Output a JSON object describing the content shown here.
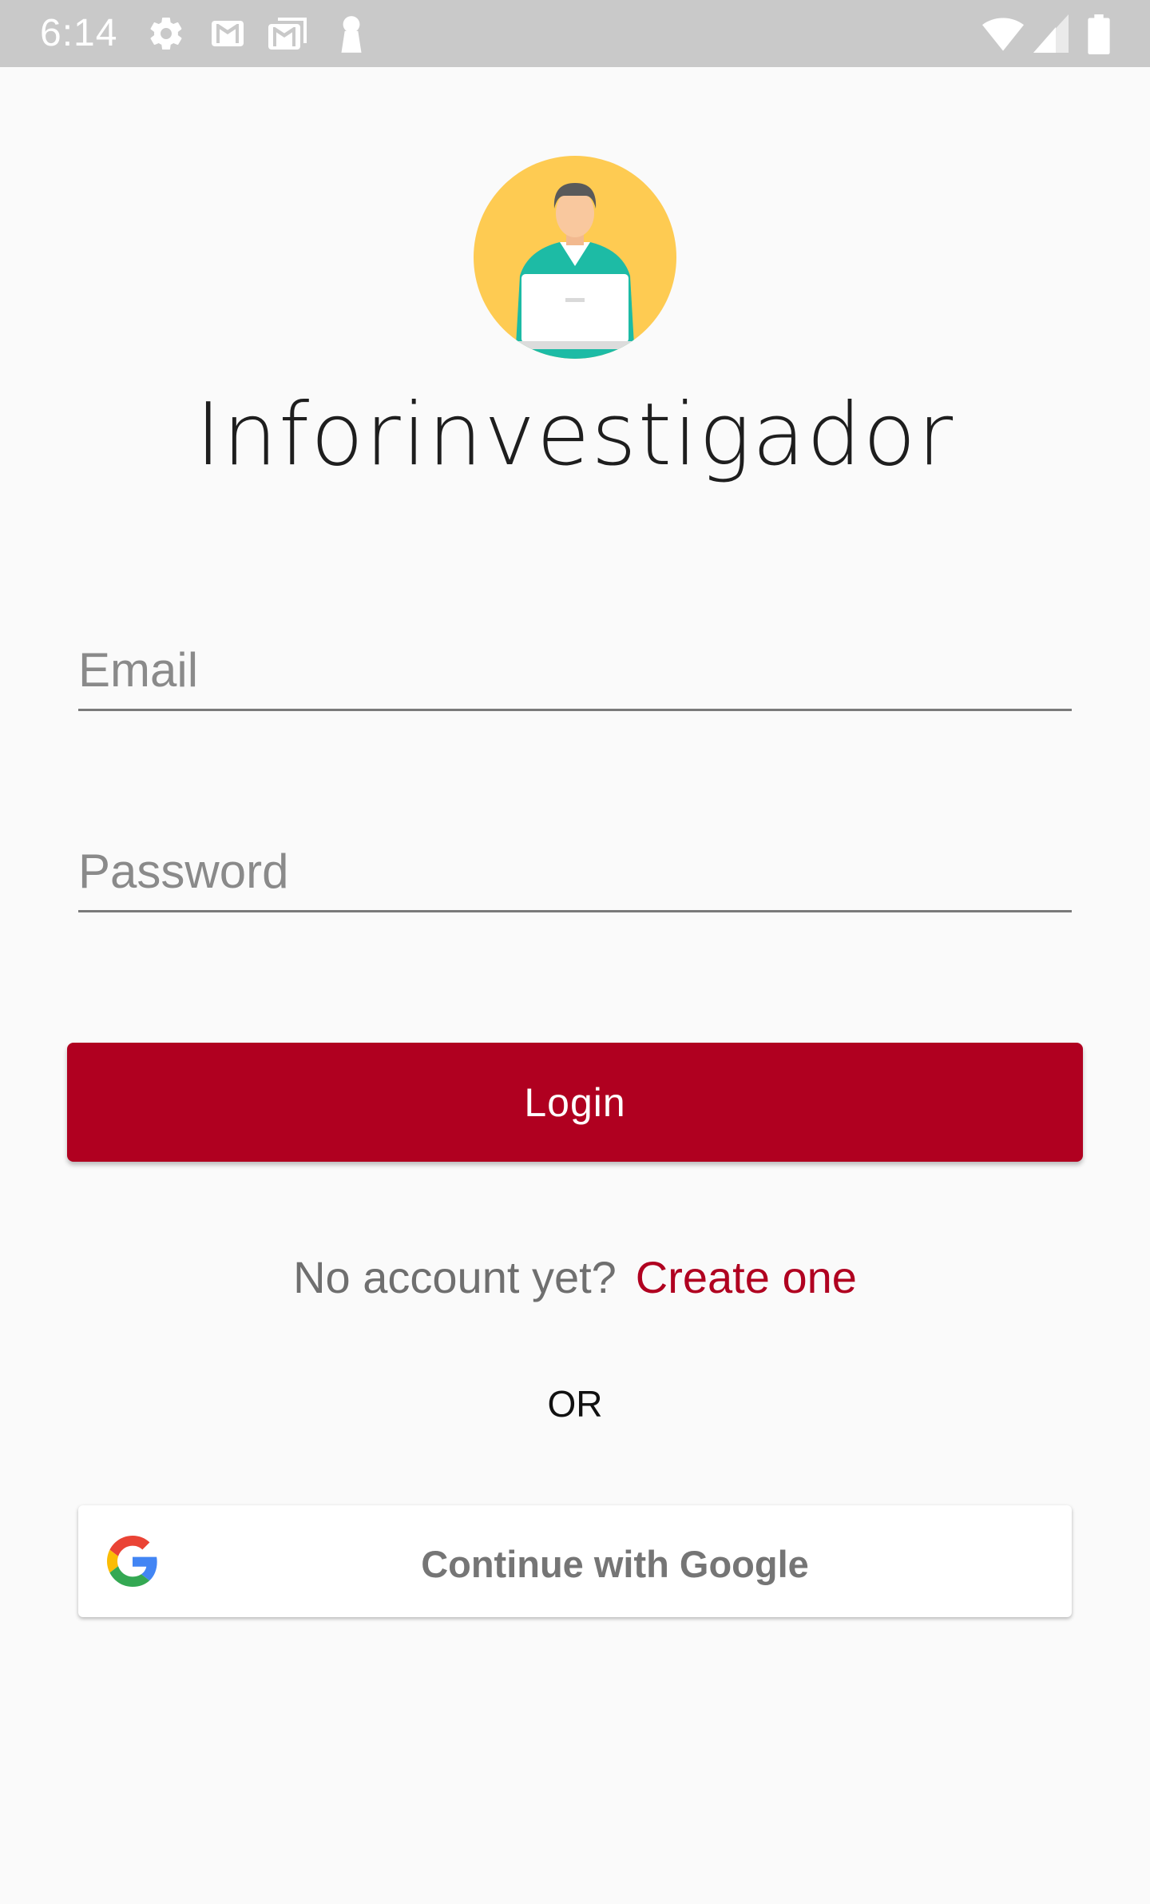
{
  "status_bar": {
    "time": "6:14",
    "icons": [
      "gear-icon",
      "gmail-icon",
      "gmail-stack-icon",
      "keyhole-icon",
      "wifi-icon",
      "signal-icon",
      "battery-icon"
    ]
  },
  "app": {
    "title": "Inforinvestigador",
    "accent_color": "#b00020"
  },
  "form": {
    "email_placeholder": "Email",
    "password_placeholder": "Password",
    "login_label": "Login"
  },
  "signup": {
    "prompt": "No account yet?",
    "link": "Create one"
  },
  "divider": {
    "or": "OR"
  },
  "google": {
    "label": "Continue with Google",
    "icon": "google-logo-icon"
  }
}
